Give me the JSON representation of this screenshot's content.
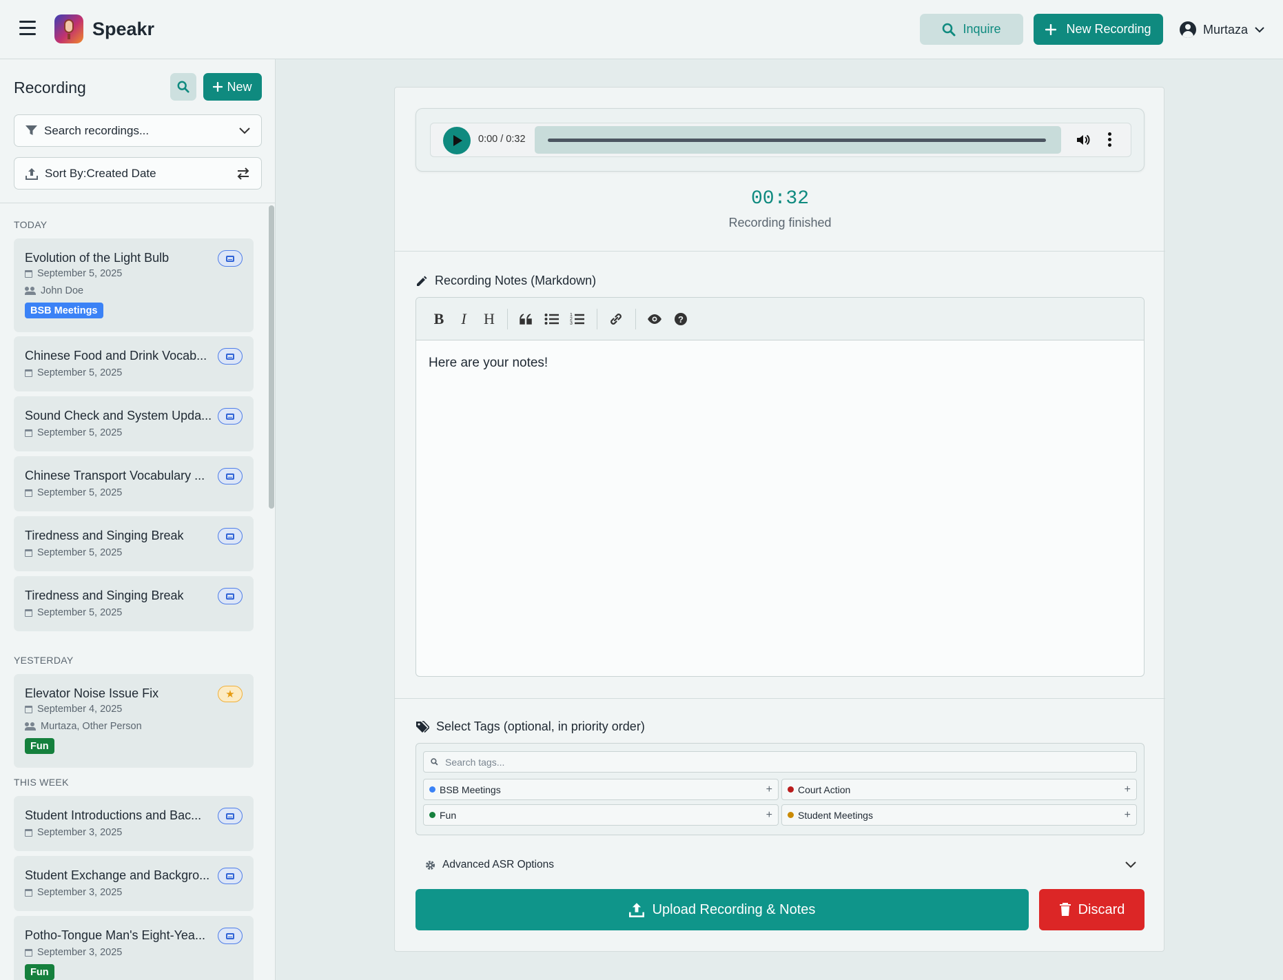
{
  "header": {
    "app_name": "Speakr",
    "inquire_label": "Inquire",
    "new_recording_label": "New Recording",
    "user_name": "Murtaza"
  },
  "sidebar": {
    "title": "Recording",
    "new_label": "New",
    "search_placeholder": "Search recordings...",
    "sort_label": "Sort By:Created Date",
    "groups": [
      {
        "label": "TODAY",
        "items": [
          {
            "title": "Evolution of the Light Bulb",
            "date": "September 5, 2025",
            "participants": "John Doe",
            "tag": "BSB Meetings",
            "badge": "inbox-icon"
          },
          {
            "title": "Chinese Food and Drink Vocab...",
            "date": "September 5, 2025",
            "badge": "inbox-icon"
          },
          {
            "title": "Sound Check and System Upda...",
            "date": "September 5, 2025",
            "badge": "inbox-icon"
          },
          {
            "title": "Chinese Transport Vocabulary ...",
            "date": "September 5, 2025",
            "badge": "inbox-icon"
          },
          {
            "title": "Tiredness and Singing Break",
            "date": "September 5, 2025",
            "badge": "inbox-icon"
          },
          {
            "title": "Tiredness and Singing Break",
            "date": "September 5, 2025",
            "badge": "inbox-icon"
          }
        ]
      },
      {
        "label": "YESTERDAY",
        "items": [
          {
            "title": "Elevator Noise Issue Fix",
            "date": "September 4, 2025",
            "participants": "Murtaza, Other Person",
            "tag": "Fun",
            "badge": "star-icon"
          }
        ]
      },
      {
        "label": "THIS WEEK",
        "items": [
          {
            "title": "Student Introductions and Bac...",
            "date": "September 3, 2025",
            "badge": "inbox-icon"
          },
          {
            "title": "Student Exchange and Backgro...",
            "date": "September 3, 2025",
            "badge": "inbox-icon"
          },
          {
            "title": "Potho-Tongue Man's Eight-Yea...",
            "date": "September 3, 2025",
            "tag": "Fun",
            "badge": "inbox-icon"
          }
        ]
      }
    ]
  },
  "player": {
    "time_display": "0:00 / 0:32",
    "timer": "00:32",
    "status": "Recording finished"
  },
  "notes": {
    "label": "Recording Notes (Markdown)",
    "content": "Here are your notes!"
  },
  "tags": {
    "label": "Select Tags (optional, in priority order)",
    "search_placeholder": "Search tags...",
    "options": [
      {
        "name": "BSB Meetings",
        "color": "#3b82f6"
      },
      {
        "name": "Court Action",
        "color": "#b91c1c"
      },
      {
        "name": "Fun",
        "color": "#15803d"
      },
      {
        "name": "Student Meetings",
        "color": "#ca8a04"
      }
    ]
  },
  "advanced": {
    "label": "Advanced ASR Options"
  },
  "actions": {
    "upload_label": "Upload Recording & Notes",
    "discard_label": "Discard"
  },
  "colors": {
    "accent": "#0f8a7f",
    "danger": "#dc2626",
    "tag_bsb": "#3b82f6",
    "tag_fun": "#15803d"
  }
}
